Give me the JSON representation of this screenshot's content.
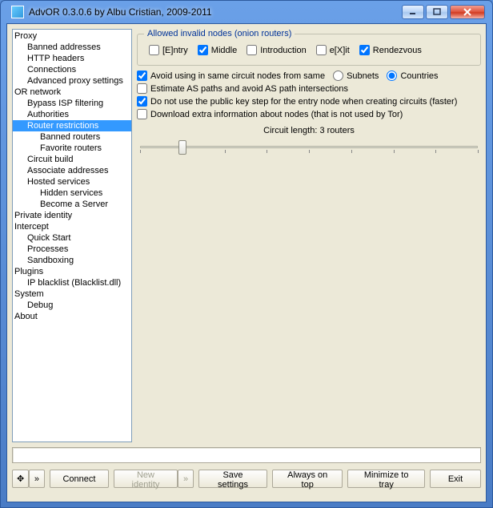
{
  "window": {
    "title": "AdvOR  0.3.0.6 by Albu Cristian, 2009-2011"
  },
  "tree": [
    {
      "lvl": 0,
      "label": "Proxy"
    },
    {
      "lvl": 1,
      "label": "Banned addresses"
    },
    {
      "lvl": 1,
      "label": "HTTP headers"
    },
    {
      "lvl": 1,
      "label": "Connections"
    },
    {
      "lvl": 1,
      "label": "Advanced proxy settings"
    },
    {
      "lvl": 0,
      "label": "OR network"
    },
    {
      "lvl": 1,
      "label": "Bypass ISP filtering"
    },
    {
      "lvl": 1,
      "label": "Authorities"
    },
    {
      "lvl": 1,
      "label": "Router restrictions",
      "selected": true
    },
    {
      "lvl": 2,
      "label": "Banned routers"
    },
    {
      "lvl": 2,
      "label": "Favorite routers"
    },
    {
      "lvl": 1,
      "label": "Circuit build"
    },
    {
      "lvl": 1,
      "label": "Associate addresses"
    },
    {
      "lvl": 1,
      "label": "Hosted services"
    },
    {
      "lvl": 2,
      "label": "Hidden services"
    },
    {
      "lvl": 2,
      "label": "Become a Server"
    },
    {
      "lvl": 0,
      "label": "Private identity"
    },
    {
      "lvl": 0,
      "label": "Intercept"
    },
    {
      "lvl": 1,
      "label": "Quick Start"
    },
    {
      "lvl": 1,
      "label": "Processes"
    },
    {
      "lvl": 1,
      "label": "Sandboxing"
    },
    {
      "lvl": 0,
      "label": "Plugins"
    },
    {
      "lvl": 1,
      "label": "IP blacklist (Blacklist.dll)"
    },
    {
      "lvl": 0,
      "label": "System"
    },
    {
      "lvl": 1,
      "label": "Debug"
    },
    {
      "lvl": 0,
      "label": "About"
    }
  ],
  "group": {
    "legend": "Allowed invalid nodes (onion routers)"
  },
  "allowed": {
    "entry": {
      "label": "[E]ntry",
      "checked": false
    },
    "middle": {
      "label": "Middle",
      "checked": true
    },
    "introduction": {
      "label": "Introduction",
      "checked": false
    },
    "exit": {
      "label": "e[X]it",
      "checked": false
    },
    "rendezvous": {
      "label": "Rendezvous",
      "checked": true
    }
  },
  "options": {
    "avoid_same": {
      "label": "Avoid using in same circuit nodes from same",
      "checked": true
    },
    "subnets": {
      "label": "Subnets"
    },
    "countries": {
      "label": "Countries",
      "selected": true
    },
    "estimate_as": {
      "label": "Estimate AS paths and avoid AS path intersections",
      "checked": false
    },
    "no_pubkey": {
      "label": "Do not use the public key step for the entry node when creating circuits (faster)",
      "checked": true
    },
    "extra_info": {
      "label": "Download extra information about nodes (that is not used by Tor)",
      "checked": false
    }
  },
  "slider": {
    "label": "Circuit length: 3 routers",
    "min": 2,
    "max": 10,
    "value": 3
  },
  "buttons": {
    "move": "✥",
    "move_more": "»",
    "connect": "Connect",
    "new_identity": "New identity",
    "new_identity_more": "»",
    "save": "Save settings",
    "always_on_top": "Always on top",
    "minimize": "Minimize to tray",
    "exit": "Exit"
  }
}
